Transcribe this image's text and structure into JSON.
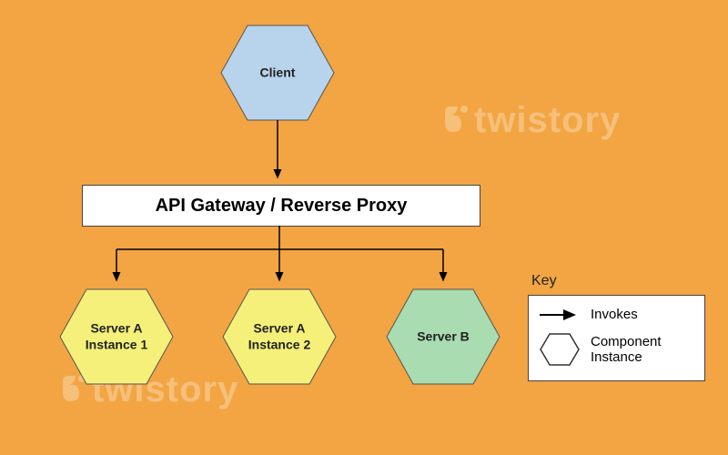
{
  "nodes": {
    "client": "Client",
    "gateway": "API Gateway / Reverse Proxy",
    "serverA1_l1": "Server A",
    "serverA1_l2": "Instance 1",
    "serverA2_l1": "Server A",
    "serverA2_l2": "Instance 2",
    "serverB": "Server B"
  },
  "legend": {
    "title": "Key",
    "invokes": "Invokes",
    "component_l1": "Component",
    "component_l2": "Instance"
  },
  "watermark": "twistory",
  "colors": {
    "client": "#b8d4ec",
    "serverA": "#f4f07a",
    "serverB": "#a9dcb0",
    "stroke": "#555"
  }
}
